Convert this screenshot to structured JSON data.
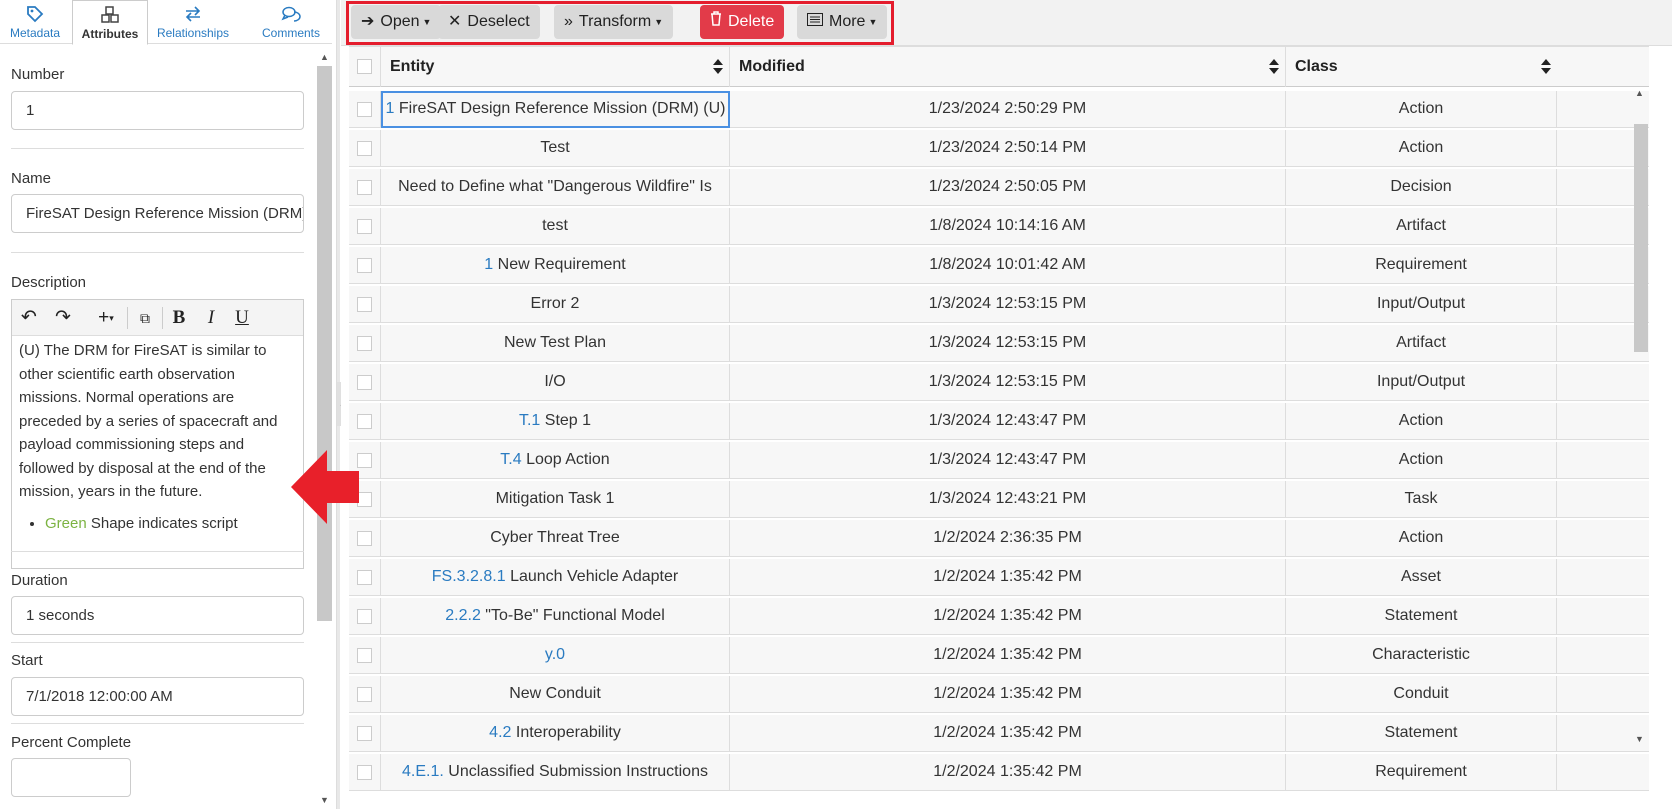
{
  "tabs": [
    {
      "label": "Metadata",
      "icon": "tag-icon"
    },
    {
      "label": "Attributes",
      "icon": "cubes-icon"
    },
    {
      "label": "Relationships",
      "icon": "arrows-exchange-icon"
    },
    {
      "label": "Comments",
      "icon": "speech-bubbles-icon"
    }
  ],
  "form": {
    "number_label": "Number",
    "number_value": "1",
    "name_label": "Name",
    "name_value": "FireSAT Design Reference Mission (DRM) (U)",
    "description_label": "Description",
    "description_text": "(U) The DRM for FireSAT is similar to other scientific earth observation missions. Normal operations are preceded by a series of spacecraft and payload commissioning steps and followed by disposal at the end of the mission, years in the future.",
    "description_bullet_colored": "Green",
    "description_bullet_rest": " Shape indicates script",
    "duration_label": "Duration",
    "duration_value": "1 seconds",
    "start_label": "Start",
    "start_value": "7/1/2018 12:00:00 AM",
    "percent_label": "Percent Complete"
  },
  "toolbar": {
    "open": "Open",
    "deselect": "Deselect",
    "transform": "Transform",
    "delete": "Delete",
    "more": "More"
  },
  "grid": {
    "headers": {
      "entity": "Entity",
      "modified": "Modified",
      "class": "Class"
    },
    "rows": [
      {
        "num": "1",
        "name": "FireSAT Design Reference Mission (DRM) (U)",
        "modified": "1/23/2024 2:50:29 PM",
        "class": "Action"
      },
      {
        "num": "",
        "name": "Test",
        "modified": "1/23/2024 2:50:14 PM",
        "class": "Action"
      },
      {
        "num": "",
        "name": "Need to Define what \"Dangerous Wildfire\" Is",
        "modified": "1/23/2024 2:50:05 PM",
        "class": "Decision"
      },
      {
        "num": "",
        "name": "test",
        "modified": "1/8/2024 10:14:16 AM",
        "class": "Artifact"
      },
      {
        "num": "1",
        "name": "New Requirement",
        "modified": "1/8/2024 10:01:42 AM",
        "class": "Requirement"
      },
      {
        "num": "",
        "name": "Error 2",
        "modified": "1/3/2024 12:53:15 PM",
        "class": "Input/Output"
      },
      {
        "num": "",
        "name": "New Test Plan",
        "modified": "1/3/2024 12:53:15 PM",
        "class": "Artifact"
      },
      {
        "num": "",
        "name": "I/O",
        "modified": "1/3/2024 12:53:15 PM",
        "class": "Input/Output"
      },
      {
        "num": "T.1",
        "name": "Step 1",
        "modified": "1/3/2024 12:43:47 PM",
        "class": "Action"
      },
      {
        "num": "T.4",
        "name": "Loop Action",
        "modified": "1/3/2024 12:43:47 PM",
        "class": "Action"
      },
      {
        "num": "",
        "name": "Mitigation Task 1",
        "modified": "1/3/2024 12:43:21 PM",
        "class": "Task"
      },
      {
        "num": "",
        "name": "Cyber Threat Tree",
        "modified": "1/2/2024 2:36:35 PM",
        "class": "Action"
      },
      {
        "num": "FS.3.2.8.1",
        "name": "Launch Vehicle Adapter",
        "modified": "1/2/2024 1:35:42 PM",
        "class": "Asset"
      },
      {
        "num": "2.2.2",
        "name": "\"To-Be\" Functional Model",
        "modified": "1/2/2024 1:35:42 PM",
        "class": "Statement"
      },
      {
        "num": "y.0",
        "name": "",
        "modified": "1/2/2024 1:35:42 PM",
        "class": "Characteristic"
      },
      {
        "num": "",
        "name": "New Conduit",
        "modified": "1/2/2024 1:35:42 PM",
        "class": "Conduit"
      },
      {
        "num": "4.2",
        "name": "Interoperability",
        "modified": "1/2/2024 1:35:42 PM",
        "class": "Statement"
      },
      {
        "num": "4.E.1.",
        "name": "Unclassified Submission Instructions",
        "modified": "1/2/2024 1:35:42 PM",
        "class": "Requirement"
      }
    ]
  },
  "colors": {
    "accent": "#2a7bc1",
    "danger": "#e23b49",
    "highlight": "#e41d2d",
    "annotation_arrow": "#e8202a",
    "green": "#7cb342"
  }
}
